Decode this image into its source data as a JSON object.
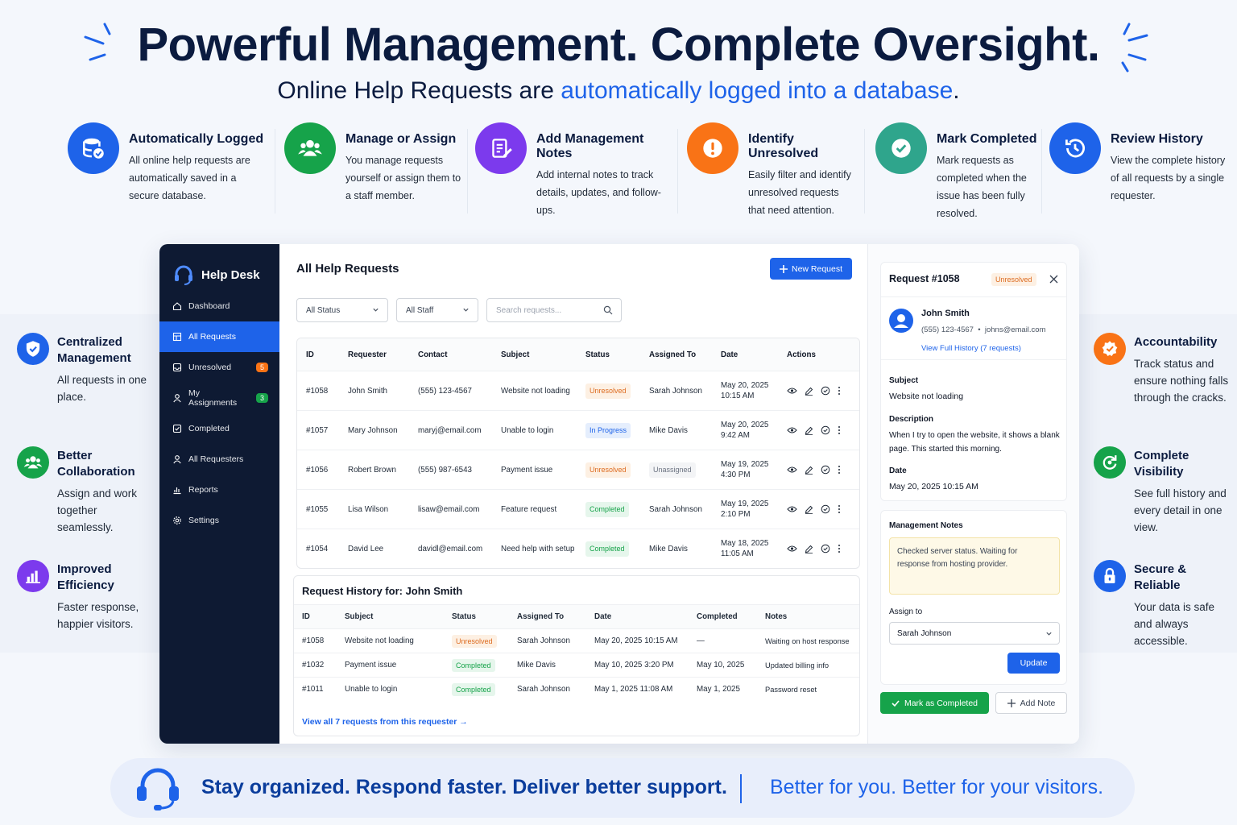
{
  "hero": {
    "title": "Powerful Management. Complete Oversight.",
    "subtitle_prefix": "Online Help Requests are ",
    "subtitle_highlight": "automatically logged into a database",
    "subtitle_suffix": "."
  },
  "features": [
    {
      "title": "Automatically Logged",
      "desc": "All online help requests are automatically saved in a secure database.",
      "icon": "database-check-icon",
      "color": "#1e63e9"
    },
    {
      "title": "Manage or Assign",
      "desc": "You manage requests yourself or assign them to a staff member.",
      "icon": "users-icon",
      "color": "#16a34a"
    },
    {
      "title": "Add Management Notes",
      "desc": "Add internal notes to track details, updates, and follow-ups.",
      "icon": "note-edit-icon",
      "color": "#7c3aed"
    },
    {
      "title": "Identify Unresolved",
      "desc": "Easily filter and identify unresolved requests that need attention.",
      "icon": "alert-icon",
      "color": "#f97316"
    },
    {
      "title": "Mark Completed",
      "desc": "Mark requests as completed when the issue has been fully resolved.",
      "icon": "check-circle-icon",
      "color": "#2fa58c"
    },
    {
      "title": "Review History",
      "desc": "View the complete history of all requests by a single requester.",
      "icon": "history-icon",
      "color": "#1e63e9"
    }
  ],
  "left_benefits": [
    {
      "title": "Centralized Management",
      "desc": "All requests in one place.",
      "icon": "shield-check-icon",
      "color": "#1e63e9"
    },
    {
      "title": "Better Collaboration",
      "desc": "Assign and work together seamlessly.",
      "icon": "users-icon",
      "color": "#16a34a"
    },
    {
      "title": "Improved Efficiency",
      "desc": "Faster response, happier visitors.",
      "icon": "bar-chart-icon",
      "color": "#7c3aed"
    }
  ],
  "right_benefits": [
    {
      "title": "Accountability",
      "desc": "Track status and ensure nothing falls through the cracks.",
      "icon": "badge-check-icon",
      "color": "#f97316"
    },
    {
      "title": "Complete Visibility",
      "desc": "See full history and every detail in one view.",
      "icon": "refresh-icon",
      "color": "#16a34a"
    },
    {
      "title": "Secure & Reliable",
      "desc": "Your data is safe and always accessible.",
      "icon": "lock-icon",
      "color": "#1e63e9"
    }
  ],
  "sidebar": {
    "brand": "Help Desk",
    "items": [
      {
        "label": "Dashboard",
        "icon": "home-icon"
      },
      {
        "label": "All Requests",
        "icon": "grid-icon",
        "active": true
      },
      {
        "label": "Unresolved",
        "icon": "inbox-icon",
        "badge": "5",
        "badge_color": "#f97316"
      },
      {
        "label": "My Assignments",
        "icon": "user-icon",
        "badge": "3",
        "badge_color": "#16a34a"
      },
      {
        "label": "Completed",
        "icon": "checkbox-icon"
      },
      {
        "label": "All Requesters",
        "icon": "user-icon"
      },
      {
        "label": "Reports",
        "icon": "reports-icon"
      },
      {
        "label": "Settings",
        "icon": "gear-icon"
      }
    ]
  },
  "main": {
    "title": "All Help Requests",
    "new_button": "New Request",
    "filter_status": "All Status",
    "filter_staff": "All Staff",
    "search_placeholder": "Search requests...",
    "columns": [
      "ID",
      "Requester",
      "Contact",
      "Subject",
      "Status",
      "Assigned To",
      "Date",
      "Actions"
    ],
    "rows": [
      {
        "id": "#1058",
        "requester": "John Smith",
        "contact": "(555) 123-4567",
        "subject": "Website not loading",
        "status": "Unresolved",
        "status_kind": "unres",
        "assigned": "Sarah Johnson",
        "assigned_kind": "text",
        "date": "May 20, 2025",
        "time": "10:15 AM"
      },
      {
        "id": "#1057",
        "requester": "Mary Johnson",
        "contact": "maryj@email.com",
        "subject": "Unable to login",
        "status": "In Progress",
        "status_kind": "prog",
        "assigned": "Mike Davis",
        "assigned_kind": "text",
        "date": "May 20, 2025",
        "time": "9:42 AM"
      },
      {
        "id": "#1056",
        "requester": "Robert Brown",
        "contact": "(555) 987-6543",
        "subject": "Payment issue",
        "status": "Unresolved",
        "status_kind": "unres",
        "assigned": "Unassigned",
        "assigned_kind": "pill",
        "date": "May 19, 2025",
        "time": "4:30 PM"
      },
      {
        "id": "#1055",
        "requester": "Lisa Wilson",
        "contact": "lisaw@email.com",
        "subject": "Feature request",
        "status": "Completed",
        "status_kind": "comp",
        "assigned": "Sarah Johnson",
        "assigned_kind": "text",
        "date": "May 19, 2025",
        "time": "2:10 PM"
      },
      {
        "id": "#1054",
        "requester": "David Lee",
        "contact": "davidl@email.com",
        "subject": "Need help with setup",
        "status": "Completed",
        "status_kind": "comp",
        "assigned": "Mike Davis",
        "assigned_kind": "text",
        "date": "May 18, 2025",
        "time": "11:05 AM"
      }
    ]
  },
  "history": {
    "title": "Request History for: John Smith",
    "columns": [
      "ID",
      "Subject",
      "Status",
      "Assigned To",
      "Date",
      "Completed",
      "Notes"
    ],
    "rows": [
      {
        "id": "#1058",
        "subject": "Website not loading",
        "status": "Unresolved",
        "status_kind": "unres",
        "assigned": "Sarah Johnson",
        "date": "May 20, 2025 10:15 AM",
        "completed": "—",
        "notes": "Waiting on host response"
      },
      {
        "id": "#1032",
        "subject": "Payment issue",
        "status": "Completed",
        "status_kind": "comp",
        "assigned": "Mike Davis",
        "date": "May 10, 2025 3:20 PM",
        "completed": "May 10, 2025",
        "notes": "Updated billing info"
      },
      {
        "id": "#1011",
        "subject": "Unable to login",
        "status": "Completed",
        "status_kind": "comp",
        "assigned": "Sarah Johnson",
        "date": "May 1, 2025 11:08 AM",
        "completed": "May 1, 2025",
        "notes": "Password reset"
      }
    ],
    "view_all": "View all 7 requests from this requester →"
  },
  "detail": {
    "title": "Request #1058",
    "status": "Unresolved",
    "name": "John Smith",
    "phone": "(555) 123-4567",
    "email": "johns@email.com",
    "history_link": "View Full History (7 requests)",
    "subject_label": "Subject",
    "subject": "Website not loading",
    "description_label": "Description",
    "description": "When I try to open the website, it shows a blank page. This started this morning.",
    "date_label": "Date",
    "date": "May 20, 2025 10:15 AM",
    "notes_label": "Management Notes",
    "notes": "Checked server status. Waiting for response from hosting provider.",
    "assign_label": "Assign to",
    "assign_value": "Sarah Johnson",
    "update_button": "Update",
    "complete_button": "Mark as Completed",
    "add_note_button": "Add Note"
  },
  "footer": {
    "left": "Stay organized. Respond faster. Deliver better support.",
    "right": "Better for you. Better for your visitors."
  }
}
